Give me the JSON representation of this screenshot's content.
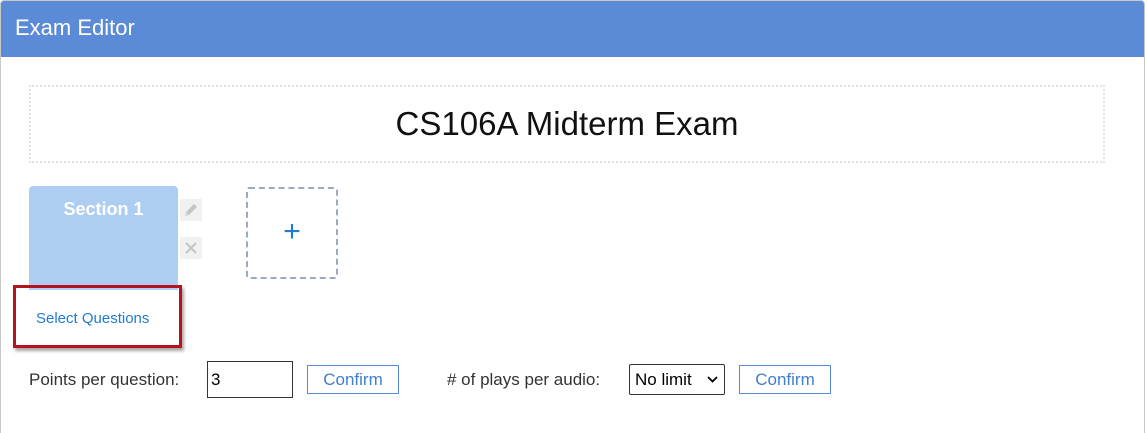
{
  "window": {
    "title": "Exam Editor"
  },
  "exam": {
    "title": "CS106A Midterm Exam"
  },
  "sections": [
    {
      "label": "Section 1"
    }
  ],
  "add_section": {
    "label": "+"
  },
  "select_questions": {
    "label": "Select Questions"
  },
  "settings": {
    "points_label": "Points per question:",
    "points_value": "3",
    "confirm_label": "Confirm",
    "plays_label": "# of plays per audio:",
    "plays_selected": "No limit",
    "plays_confirm_label": "Confirm"
  },
  "icons": {
    "edit": "pencil-icon",
    "delete": "close-icon",
    "dropdown": "chevron-down-icon"
  },
  "colors": {
    "titlebar": "#5b8bd6",
    "section_tab": "#aecdf3",
    "link": "#1f7bd3",
    "highlight": "#b4141d"
  }
}
